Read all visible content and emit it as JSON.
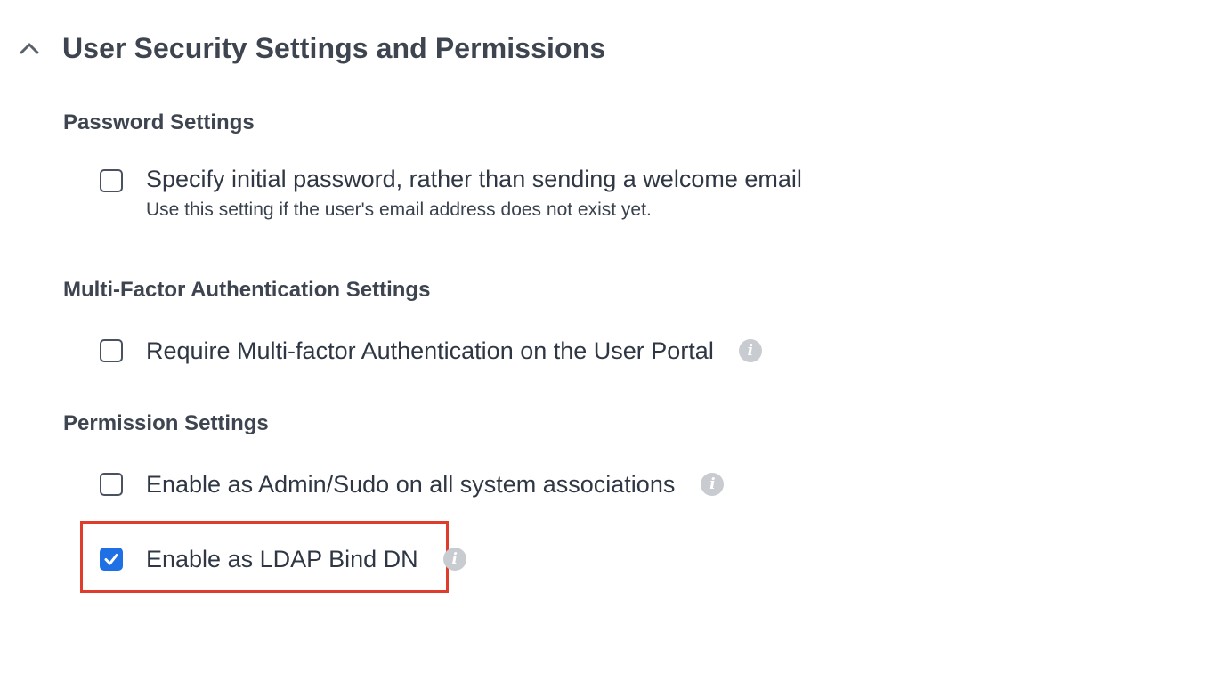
{
  "section": {
    "title": "User Security Settings and Permissions",
    "toggle_icon": "chevron-up-icon"
  },
  "password_settings": {
    "title": "Password Settings",
    "option": {
      "label": "Specify initial password, rather than sending a welcome email",
      "help": "Use this setting if the user's email address does not exist yet.",
      "checked": false
    }
  },
  "mfa_settings": {
    "title": "Multi-Factor Authentication Settings",
    "option": {
      "label": "Require Multi-factor Authentication on the User Portal",
      "checked": false,
      "info_icon": "info-icon"
    }
  },
  "permission_settings": {
    "title": "Permission Settings",
    "options": [
      {
        "label": "Enable as Admin/Sudo on all system associations",
        "checked": false,
        "info_icon": "info-icon"
      },
      {
        "label": "Enable as LDAP Bind DN",
        "checked": true,
        "info_icon": "info-icon"
      }
    ]
  },
  "colors": {
    "checkbox_checked": "#1f6fe5",
    "highlight_border": "#e03c2c",
    "info_icon": "#c8cbd0",
    "text": "#2f3744"
  }
}
